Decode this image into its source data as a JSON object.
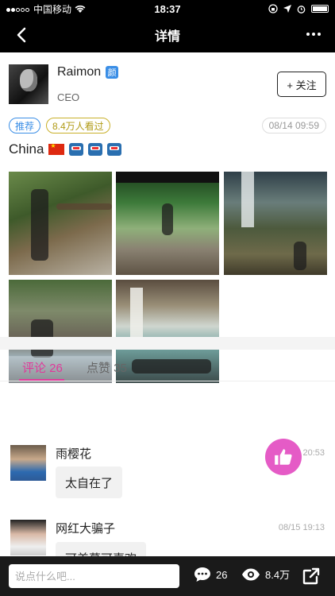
{
  "status_bar": {
    "carrier": "中国移动",
    "time": "18:37"
  },
  "nav": {
    "title": "详情"
  },
  "post": {
    "user_name": "Raimon",
    "verified_badge": "颜",
    "role": "CEO",
    "follow_label": "+ 关注",
    "tag_recommend": "推荐",
    "tag_views": "8.4万人看过",
    "date": "08/14 09:59",
    "text": "China"
  },
  "tabs": [
    {
      "label": "评论 26",
      "active": true
    },
    {
      "label": "点赞 35",
      "active": false
    }
  ],
  "comments": [
    {
      "name": "雨樱花",
      "time": "20:53",
      "text": "太自在了"
    },
    {
      "name": "网红大骗子",
      "time": "08/15 19:13",
      "text": "可美慕可喜欢"
    }
  ],
  "bottom_bar": {
    "input_placeholder": "说点什么吧...",
    "comment_count": "26",
    "view_count": "8.4万"
  },
  "colors": {
    "accent": "#e0399a",
    "like_fab": "#e55bc6",
    "recommend": "#3a8ee6",
    "views_tag": "#c9b02a"
  }
}
